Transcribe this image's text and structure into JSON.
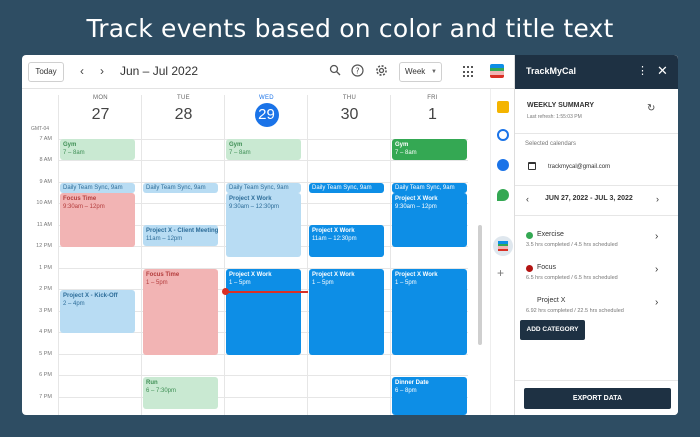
{
  "headline": "Track events based on color and title text",
  "toolbar": {
    "today_label": "Today",
    "prev_icon": "chevron-left-icon",
    "next_icon": "chevron-right-icon",
    "range_title": "Jun – Jul 2022",
    "view_label": "Week"
  },
  "timezone": "GMT-04",
  "days": [
    {
      "name": "MON",
      "num": "27"
    },
    {
      "name": "TUE",
      "num": "28"
    },
    {
      "name": "WED",
      "num": "29"
    },
    {
      "name": "THU",
      "num": "30"
    },
    {
      "name": "FRI",
      "num": "1"
    }
  ],
  "hours": [
    "7 AM",
    "8 AM",
    "9 AM",
    "10 AM",
    "11 AM",
    "12 PM",
    "1 PM",
    "2 PM",
    "3 PM",
    "4 PM",
    "5 PM",
    "6 PM",
    "7 PM"
  ],
  "events": [
    {
      "title": "Gym",
      "detail": "7 – 8am"
    },
    {
      "title": "Gym",
      "detail": "7 – 8am"
    },
    {
      "title": "Gym",
      "detail": "7 – 8am"
    },
    {
      "title": "Daily Team Sync,",
      "detail": "9am"
    },
    {
      "title": "Daily Team Sync,",
      "detail": "9am"
    },
    {
      "title": "Daily Team Sync,",
      "detail": "9am"
    },
    {
      "title": "Daily Team Sync,",
      "detail": "9am"
    },
    {
      "title": "Daily Team Sync,",
      "detail": "9am"
    },
    {
      "title": "Focus Time",
      "detail": "9:30am – 12pm"
    },
    {
      "title": "Project X - Client Meeting",
      "detail": "11am – 12pm"
    },
    {
      "title": "Project X Work",
      "detail": "9:30am – 12:30pm"
    },
    {
      "title": "Project X Work",
      "detail": "11am – 12:30pm"
    },
    {
      "title": "Project X Work",
      "detail": "9:30am – 12pm"
    },
    {
      "title": "Focus Time",
      "detail": "1 – 5pm"
    },
    {
      "title": "Project X Work",
      "detail": "1 – 5pm"
    },
    {
      "title": "Project X Work",
      "detail": "1 – 5pm"
    },
    {
      "title": "Project X Work",
      "detail": "1 – 5pm"
    },
    {
      "title": "Project X - Kick-Off",
      "detail": "2 – 4pm"
    },
    {
      "title": "Run",
      "detail": "6 – 7:30pm"
    },
    {
      "title": "Dinner Date",
      "detail": "6 – 8pm"
    }
  ],
  "panel": {
    "title": "TrackMyCal",
    "weekly_summary": "WEEKLY SUMMARY",
    "last_refresh": "Last refresh: 1:55:03 PM",
    "selected_calendars_label": "Selected calendars",
    "calendar_email": "trackmycal@gmail.com",
    "date_range": "JUN 27, 2022 - JUL 3, 2022",
    "categories": [
      {
        "name": "Exercise",
        "detail": "3.5 hrs completed / 4.5 hrs scheduled",
        "color": "#34a853"
      },
      {
        "name": "Focus",
        "detail": "6.5 hrs completed / 6.5 hrs scheduled",
        "color": "#b31412"
      },
      {
        "name": "Project X",
        "detail": "6.92 hrs completed / 22.5 hrs scheduled",
        "color": ""
      }
    ],
    "add_category_label": "ADD CATEGORY",
    "export_label": "EXPORT DATA"
  }
}
